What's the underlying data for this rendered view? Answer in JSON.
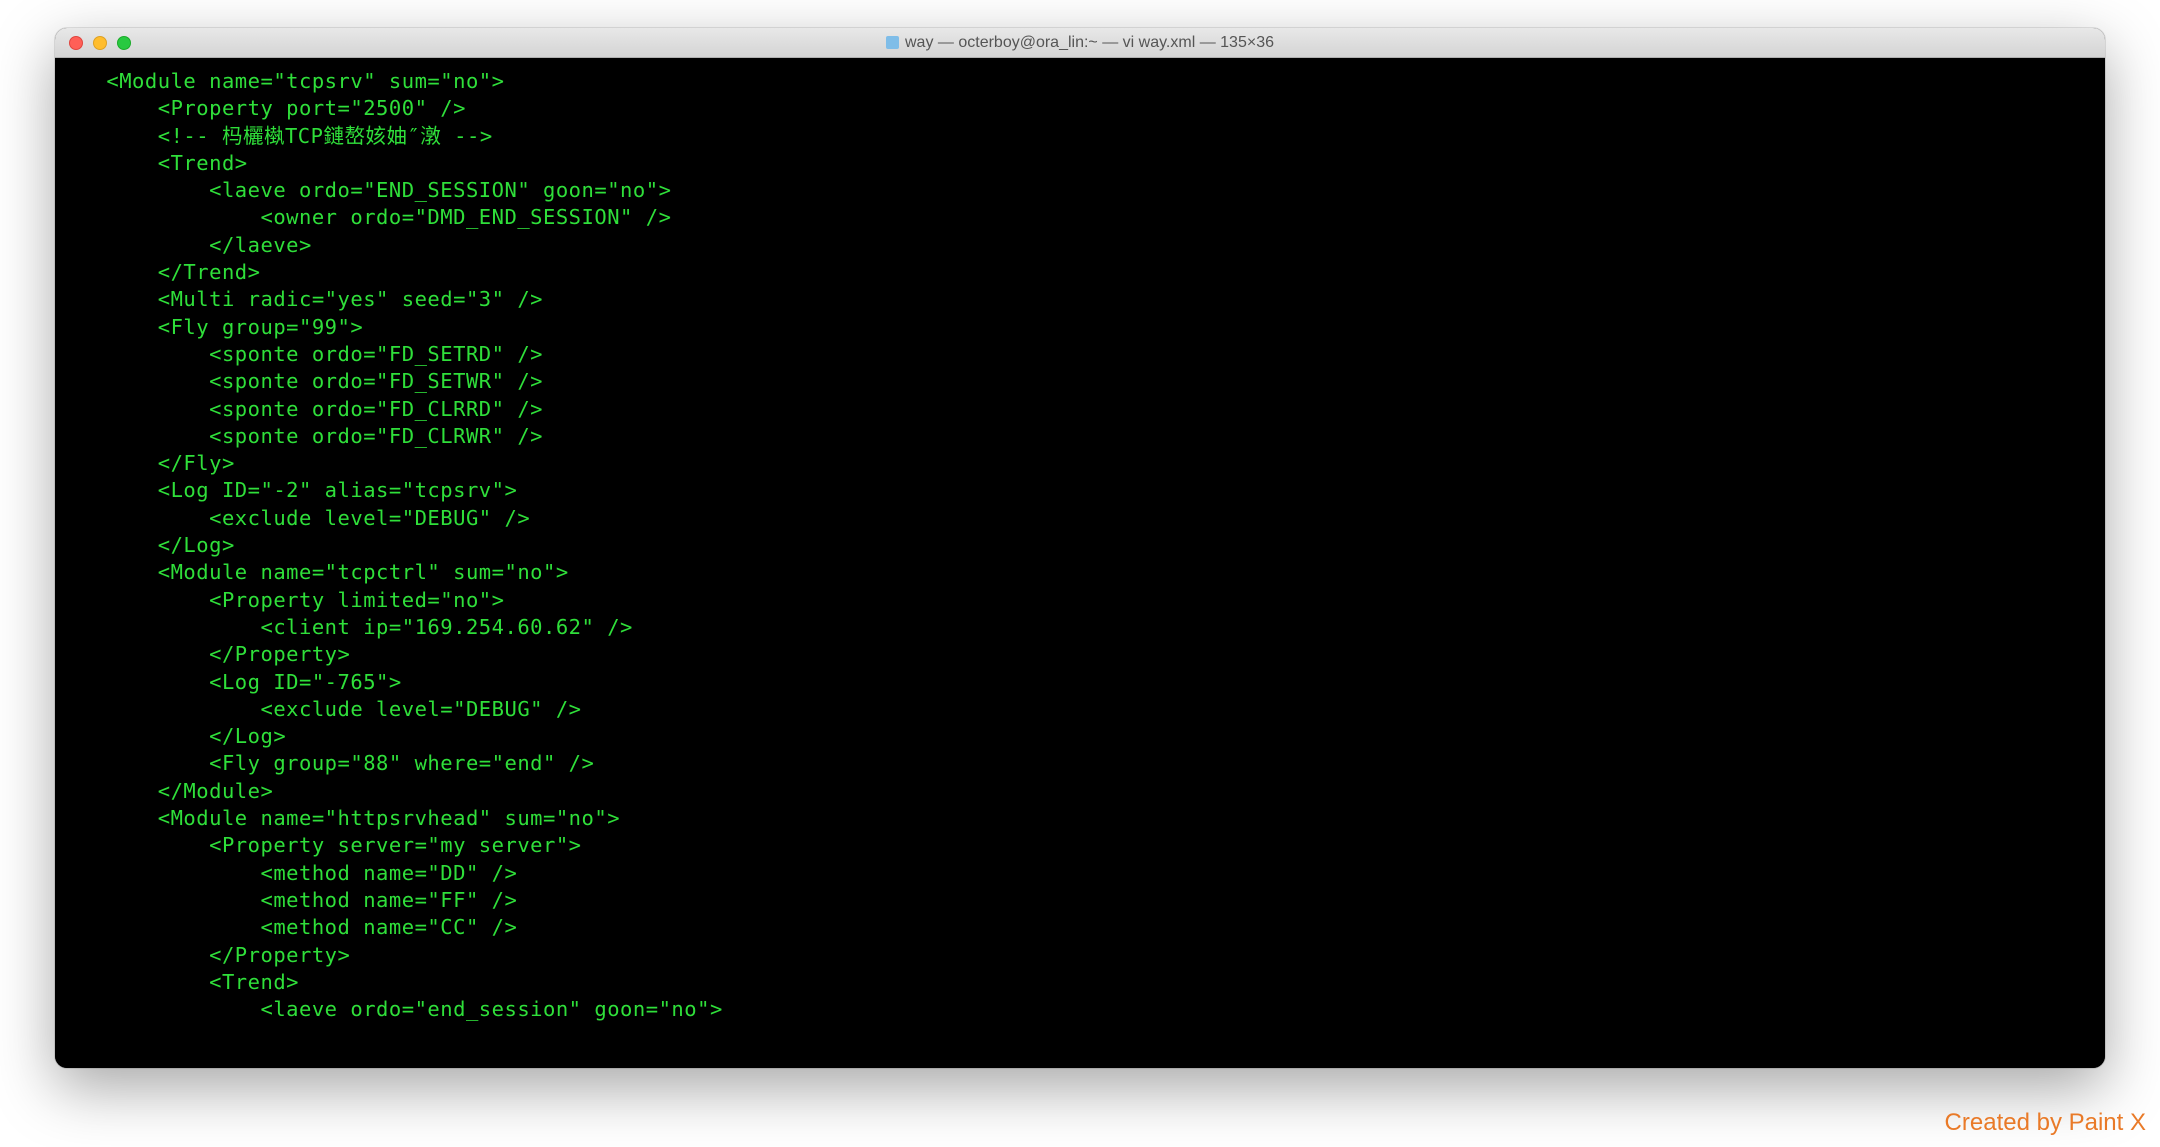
{
  "window": {
    "title": "way — octerboy@ora_lin:~ — vi way.xml — 135×36"
  },
  "terminal": {
    "lines": [
      "    <Module name=\"tcpsrv\" sum=\"no\">",
      "        <Property port=\"2500\" />",
      "        <!-- 杩欐槸TCP鏈嶅姟妯″潡 -->",
      "        <Trend>",
      "            <laeve ordo=\"END_SESSION\" goon=\"no\">",
      "                <owner ordo=\"DMD_END_SESSION\" />",
      "            </laeve>",
      "        </Trend>",
      "        <Multi radic=\"yes\" seed=\"3\" />",
      "        <Fly group=\"99\">",
      "            <sponte ordo=\"FD_SETRD\" />",
      "            <sponte ordo=\"FD_SETWR\" />",
      "            <sponte ordo=\"FD_CLRRD\" />",
      "            <sponte ordo=\"FD_CLRWR\" />",
      "        </Fly>",
      "        <Log ID=\"-2\" alias=\"tcpsrv\">",
      "            <exclude level=\"DEBUG\" />",
      "        </Log>",
      "        <Module name=\"tcpctrl\" sum=\"no\">",
      "            <Property limited=\"no\">",
      "                <client ip=\"169.254.60.62\" />",
      "            </Property>",
      "            <Log ID=\"-765\">",
      "                <exclude level=\"DEBUG\" />",
      "            </Log>",
      "            <Fly group=\"88\" where=\"end\" />",
      "        </Module>",
      "        <Module name=\"httpsrvhead\" sum=\"no\">",
      "            <Property server=\"my server\">",
      "                <method name=\"DD\" />",
      "                <method name=\"FF\" />",
      "                <method name=\"CC\" />",
      "            </Property>",
      "            <Trend>",
      "                <laeve ordo=\"end_session\" goon=\"no\">"
    ]
  },
  "watermark": "Created by Paint X"
}
